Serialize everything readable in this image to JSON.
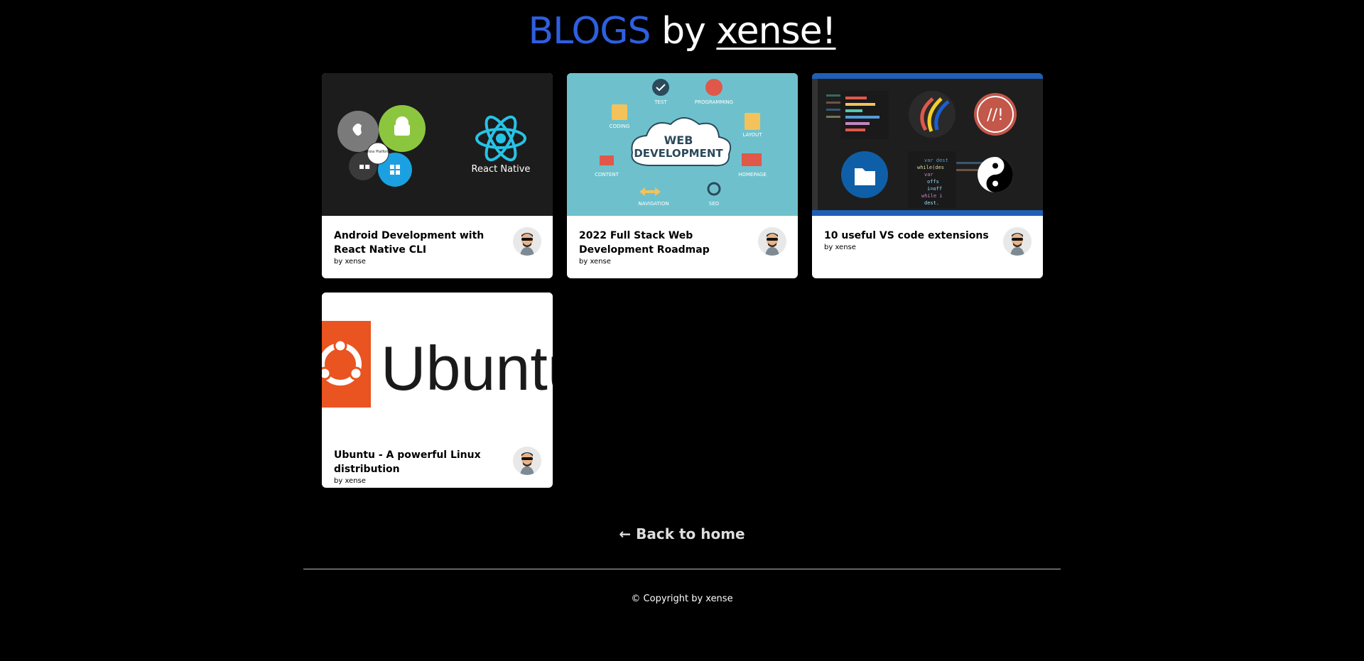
{
  "header": {
    "blogs": "BLOGS",
    "by": "by",
    "xense": "xense!"
  },
  "cards": [
    {
      "title": "Android Development with React Native CLI",
      "author": "by xense",
      "image_text": "React Native",
      "image_small": "Cross Platform"
    },
    {
      "title": "2022 Full Stack Web Development Roadmap",
      "author": "by xense",
      "image_text_1": "WEB",
      "image_text_2": "DEVELOPMENT",
      "image_labels": [
        "TEST",
        "PROGRAMMING",
        "CODING",
        "LAYOUT",
        "CONTENT",
        "HOMEPAGE",
        "NAVIGATION",
        "SEO"
      ]
    },
    {
      "title": "10 useful VS code extensions",
      "author": "by xense"
    },
    {
      "title": "Ubuntu - A powerful Linux distribution",
      "author": "by xense",
      "image_text": "Ubuntu"
    }
  ],
  "footer": {
    "back": "← Back to home",
    "copyright": "© Copyright by xense"
  },
  "colors": {
    "accent": "#2e5fe0",
    "background": "#000000",
    "card": "#ffffff",
    "ubuntu": "#e95420",
    "webdev_bg": "#6ec1cc"
  }
}
